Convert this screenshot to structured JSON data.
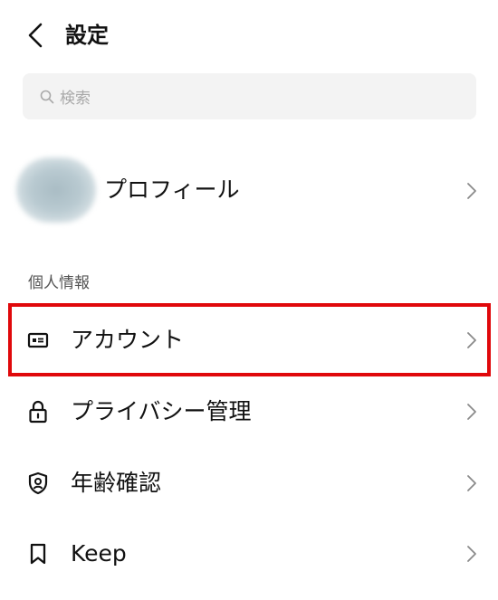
{
  "header": {
    "title": "設定"
  },
  "search": {
    "placeholder": "検索"
  },
  "profile": {
    "name": "プロフィール"
  },
  "section": {
    "personal_info": "個人情報"
  },
  "menu": [
    {
      "label": "アカウント",
      "icon": "account-card-icon"
    },
    {
      "label": "プライバシー管理",
      "icon": "lock-icon"
    },
    {
      "label": "年齢確認",
      "icon": "shield-check-icon"
    },
    {
      "label": "Keep",
      "icon": "bookmark-icon"
    }
  ],
  "colors": {
    "highlight": "#e0080b",
    "search_bg": "#f3f3f3"
  }
}
